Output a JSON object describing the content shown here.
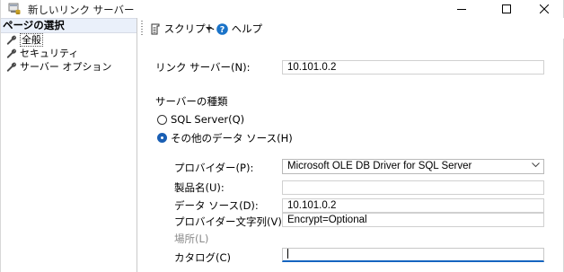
{
  "window": {
    "title": "新しいリンク サーバー",
    "icon": "database-link-icon",
    "controls": [
      "minimize-icon",
      "maximize-icon",
      "close-icon"
    ]
  },
  "left_pane": {
    "header": "ページの選択",
    "items": [
      {
        "label": "全般",
        "icon": "wrench-icon",
        "selected": true
      },
      {
        "label": "セキュリティ",
        "icon": "wrench-icon",
        "selected": false
      },
      {
        "label": "サーバー オプション",
        "icon": "wrench-icon",
        "selected": false
      }
    ]
  },
  "toolbar": {
    "script_label": "スクリプト",
    "help_label": "ヘルプ"
  },
  "form": {
    "linked_server": {
      "label": "リンク サーバー(N):",
      "value": "10.101.0.2"
    },
    "server_type_label": "サーバーの種類",
    "radio_sql_server": {
      "label": "SQL Server(Q)",
      "checked": false
    },
    "radio_other": {
      "label": "その他のデータ ソース(H)",
      "checked": true
    },
    "provider": {
      "label": "プロバイダー(P):",
      "value": "Microsoft OLE DB Driver for SQL Server"
    },
    "product_name": {
      "label": "製品名(U):",
      "value": ""
    },
    "data_source": {
      "label": "データ ソース(D):",
      "value": "10.101.0.2"
    },
    "provider_string": {
      "label": "プロバイダー文字列(V):",
      "value": "Encrypt=Optional"
    },
    "location": {
      "label": "場所(L)",
      "value": "",
      "enabled": false
    },
    "catalog": {
      "label": "カタログ(C)",
      "value": ""
    }
  },
  "colors": {
    "accent": "#1a5fb4",
    "help_icon": "#1a73c8",
    "header_bg": "#eaf0fa",
    "focus_underline": "#1565c0"
  }
}
